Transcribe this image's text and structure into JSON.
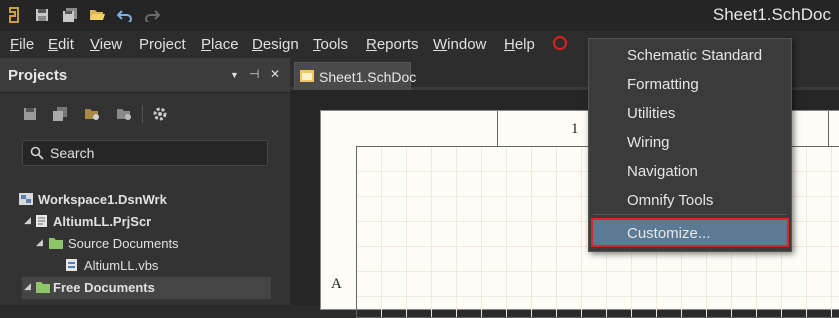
{
  "window": {
    "title": "Sheet1.SchDoc"
  },
  "toolbar": {
    "icons": [
      "altium-logo-icon",
      "save-icon",
      "save-all-icon",
      "open-folder-icon",
      "undo-icon",
      "redo-icon"
    ]
  },
  "menubar": {
    "items": [
      {
        "label": "File",
        "ul": "F",
        "rest": "ile"
      },
      {
        "label": "Edit",
        "ul": "E",
        "rest": "dit"
      },
      {
        "label": "View",
        "ul": "V",
        "rest": "iew"
      },
      {
        "label": "Project",
        "ul": "",
        "rest": "Project"
      },
      {
        "label": "Place",
        "ul": "P",
        "rest": "lace"
      },
      {
        "label": "Design",
        "ul": "D",
        "rest": "esign"
      },
      {
        "label": "Tools",
        "ul": "T",
        "rest": "ools"
      },
      {
        "label": "Reports",
        "ul": "R",
        "rest": "eports"
      },
      {
        "label": "Window",
        "ul": "W",
        "rest": "indow"
      },
      {
        "label": "Help",
        "ul": "H",
        "rest": "elp"
      }
    ]
  },
  "projects_panel": {
    "title": "Projects",
    "header_buttons": [
      "▼",
      "⊣",
      "✕"
    ],
    "search_label": "Search",
    "tree": [
      {
        "label": "Workspace1.DsnWrk",
        "bold": true
      },
      {
        "label": "AltiumLL.PrjScr",
        "bold": true
      },
      {
        "label": "Source Documents",
        "bold": false
      },
      {
        "label": "AltiumLL.vbs",
        "bold": false
      },
      {
        "label": "Free Documents",
        "bold": true
      }
    ]
  },
  "document": {
    "tab_label": "Sheet1.SchDoc",
    "zone_number": "1",
    "zone_letter": "A"
  },
  "dropdown": {
    "items": [
      "Schematic Standard",
      "Formatting",
      "Utilities",
      "Wiring",
      "Navigation",
      "Omnify Tools"
    ],
    "customize_label": "Customize..."
  },
  "colors": {
    "highlight": "#5c7a93",
    "annotation_red": "#d8262b",
    "sheet_background": "#fdfcf5"
  }
}
